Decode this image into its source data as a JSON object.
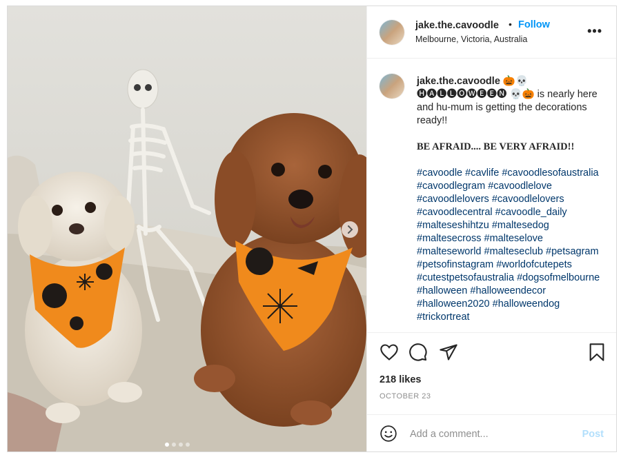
{
  "header": {
    "username": "jake.the.cavoodle",
    "separator": "•",
    "follow_label": "Follow",
    "location": "Melbourne, Victoria, Australia",
    "more_label": "•••"
  },
  "caption": {
    "username": "jake.the.cavoodle",
    "user_emoji": "🎃💀",
    "line1_word": "🅗🅐🅛🅛🅞🅦🅔🅔🅝",
    "line1_emoji": "💀🎃",
    "line1_text": "is nearly here and hu-mum is getting the decorations ready!!",
    "afraid": "BE AFRAID.... BE VERY AFRAID!!",
    "hashtags": [
      "#cavoodle",
      "#cavlife",
      "#cavoodlesofaustralia",
      "#cavoodlegram",
      "#cavoodlelove",
      "#cavoodlelovers",
      "#cavoodlelovers",
      "#cavoodlecentral",
      "#cavoodle_daily",
      "#malteseshihtzu",
      "#maltesedog",
      "#maltesecross",
      "#malteselove",
      "#malteseworld",
      "#malteseclub",
      "#petsagram",
      "#petsofinstagram",
      "#worldofcutepets",
      "#cutestpetsofaustralia",
      "#dogsofmelbourne",
      "#halloween",
      "#halloweendecor",
      "#halloween2020",
      "#halloweendog",
      "#trickortreat"
    ]
  },
  "actions": {
    "like_icon": "heart-icon",
    "comment_icon": "speech-bubble-icon",
    "share_icon": "paper-plane-icon",
    "save_icon": "bookmark-icon",
    "likes": "218 likes",
    "date": "OCTOBER 23"
  },
  "comment_box": {
    "emoji_icon": "smiley-icon",
    "placeholder": "Add a comment...",
    "post_label": "Post"
  },
  "carousel": {
    "next_icon": "chevron-right-icon",
    "slide_count": 4,
    "active_slide": 1
  },
  "colors": {
    "link_blue": "#0095f6",
    "hashtag_blue": "#00376b",
    "post_disabled": "#b2dffc",
    "bandana_orange": "#f08a1c"
  }
}
